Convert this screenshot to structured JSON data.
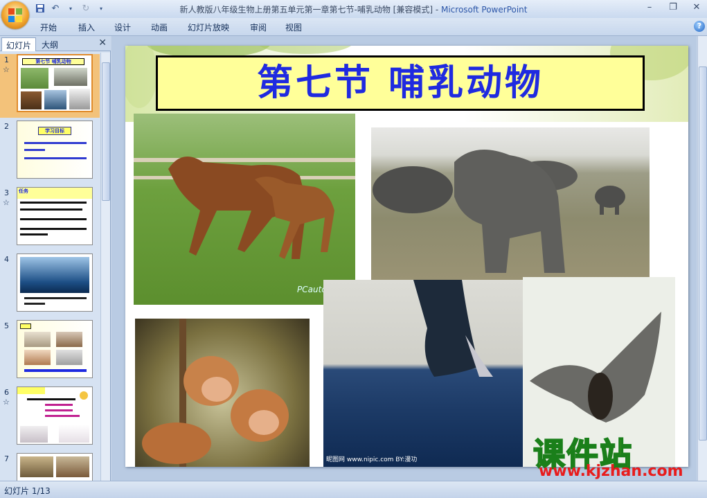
{
  "window": {
    "title": "新人教版八年级生物上册第五单元第一章第七节-哺乳动物 [兼容模式]",
    "separator": " - ",
    "app_name": "Microsoft PowerPoint",
    "minimize": "–",
    "restore": "❐",
    "close": "✕"
  },
  "ribbon": {
    "tabs": [
      "开始",
      "插入",
      "设计",
      "动画",
      "幻灯片放映",
      "审阅",
      "视图"
    ],
    "help": "?"
  },
  "left_pane": {
    "tabs": [
      "幻灯片",
      "大纲"
    ],
    "close": "✕",
    "slides": [
      {
        "num": "1",
        "text": "第七节  哺乳动物",
        "has_star": true,
        "selected": true
      },
      {
        "num": "2",
        "text": "学习目标",
        "has_star": false,
        "selected": false
      },
      {
        "num": "3",
        "text": "任务",
        "has_star": true,
        "selected": false
      },
      {
        "num": "4",
        "text": "",
        "has_star": false,
        "selected": false
      },
      {
        "num": "5",
        "text": "",
        "has_star": false,
        "selected": false
      },
      {
        "num": "6",
        "text": "",
        "has_star": true,
        "selected": false
      },
      {
        "num": "7",
        "text": "",
        "has_star": false,
        "selected": false
      }
    ]
  },
  "slide": {
    "title": "第七节  哺乳动物",
    "photo_captions": {
      "horse": "PCauto",
      "whale": "昵图网 www.nipic.com  BY:漫功"
    }
  },
  "watermark": {
    "cn": "课件站",
    "url": "www.kjzhan.com"
  },
  "status": {
    "slide_label": "幻灯片 1/13"
  },
  "colors": {
    "title_text": "#1f2ae0",
    "title_bg": "#ffff99",
    "selected_thumb": "#f3c27a"
  }
}
